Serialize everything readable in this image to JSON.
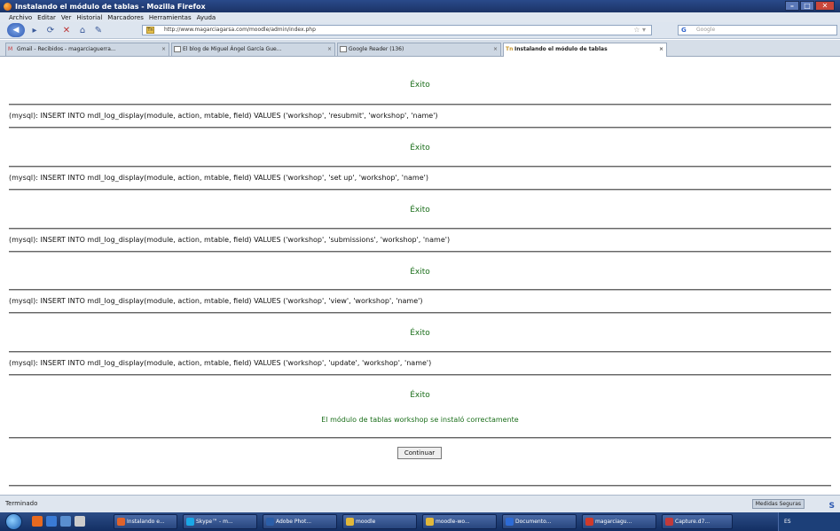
{
  "window": {
    "title": "Instalando el módulo de tablas - Mozilla Firefox"
  },
  "menu": [
    "Archivo",
    "Editar",
    "Ver",
    "Historial",
    "Marcadores",
    "Herramientas",
    "Ayuda"
  ],
  "nav": {
    "url": "http://www.magarciagarsa.com/moodle/admin/index.php",
    "search_placeholder": "Google",
    "tab_favicon_text": "Tn"
  },
  "tabs": [
    {
      "label": "Gmail - Recibidos - magarciaguerra..."
    },
    {
      "label": "El blog de Miguel Ángel García Gue..."
    },
    {
      "label": "Google Reader (136)"
    },
    {
      "label": "Instalando el módulo de tablas",
      "active": true
    }
  ],
  "content": {
    "success_label": "Éxito",
    "sql_lines": [
      "(mysql): INSERT INTO mdl_log_display(module, action, mtable, field) VALUES ('workshop', 'resubmit', 'workshop', 'name')",
      "(mysql): INSERT INTO mdl_log_display(module, action, mtable, field) VALUES ('workshop', 'set up', 'workshop', 'name')",
      "(mysql): INSERT INTO mdl_log_display(module, action, mtable, field) VALUES ('workshop', 'submissions', 'workshop', 'name')",
      "(mysql): INSERT INTO mdl_log_display(module, action, mtable, field) VALUES ('workshop', 'view', 'workshop', 'name')",
      "(mysql): INSERT INTO mdl_log_display(module, action, mtable, field) VALUES ('workshop', 'update', 'workshop', 'name')"
    ],
    "final_message": "El módulo de tablas workshop se instaló correctamente",
    "continue_button": "Continuar"
  },
  "status": {
    "text": "Terminado",
    "addon_label": "Medidas Seguras"
  },
  "taskbar": {
    "buttons": [
      {
        "label": "Instalando e...",
        "color": "#e0632b"
      },
      {
        "label": "Skype™ - m...",
        "color": "#1aa7e6"
      },
      {
        "label": "Adobe Phot...",
        "color": "#2b5ea8"
      },
      {
        "label": "moodle",
        "color": "#e2b83a"
      },
      {
        "label": "moodle-wo...",
        "color": "#e2b83a"
      },
      {
        "label": "Documento...",
        "color": "#2d6bd6"
      },
      {
        "label": "magarciagu...",
        "color": "#d03a2a"
      },
      {
        "label": "Capture.d7...",
        "color": "#c23a3a"
      }
    ],
    "clock": "ES"
  },
  "colors": {
    "success_text": "#1a6e1a",
    "titlebar": "#1b3366"
  }
}
